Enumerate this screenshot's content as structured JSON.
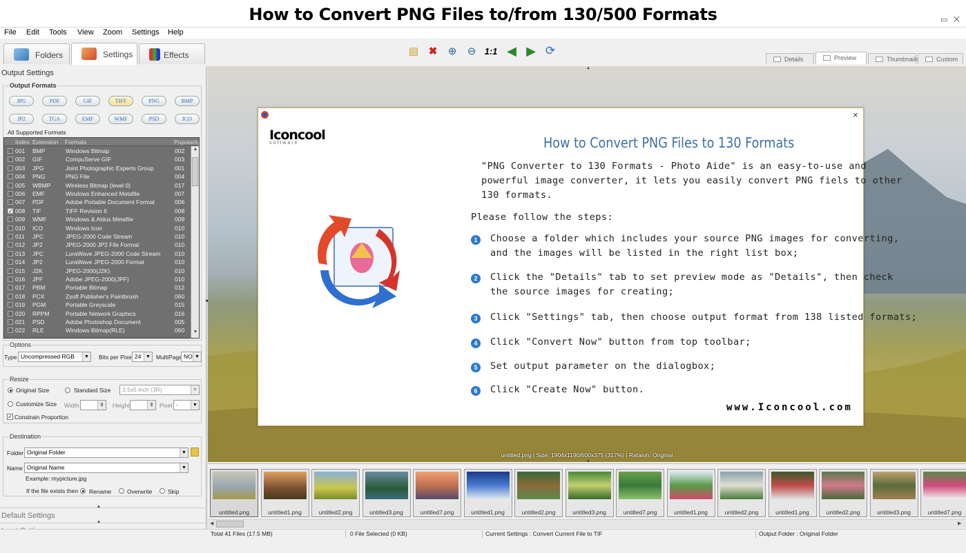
{
  "window": {
    "title": "How to Convert PNG Files to/from 130/500 Formats",
    "controls": [
      "▭",
      "⨉"
    ]
  },
  "menu": [
    "File",
    "Edit",
    "Tools",
    "View",
    "Zoom",
    "Settings",
    "Help"
  ],
  "left_tabs": [
    {
      "label": "Folders",
      "icon": "folders-icon"
    },
    {
      "label": "Settings",
      "icon": "settings-icon"
    },
    {
      "label": "Effects",
      "icon": "effects-icon"
    }
  ],
  "toolbar": [
    "open-icon",
    "delete-icon",
    "zoom-in-icon",
    "zoom-out-icon",
    "1:1",
    "previous-icon",
    "next-icon",
    "convert-icon"
  ],
  "view_tabs": [
    "Details",
    "Preview",
    "Thumbnails",
    "Custom"
  ],
  "output_settings": {
    "header": "Output Settings",
    "formats_title": "Output Formats",
    "format_buttons": [
      "JPG",
      "PDF",
      "GIF",
      "TIFF",
      "PNG",
      "BMP",
      "JP2",
      "TGA",
      "EMF",
      "WMF",
      "PSD",
      "ICO"
    ],
    "selected_format": "TIFF",
    "all_supported_label": "All Supported Formats",
    "list_columns": [
      "Index",
      "Extension",
      "Formats",
      "Popularity"
    ],
    "list_rows": [
      [
        "001",
        "BMP",
        "Windows Bitmap",
        "002"
      ],
      [
        "002",
        "GIF",
        "CompuServe GIF",
        "003"
      ],
      [
        "003",
        "JPG",
        "Joint Photographic Experts Group",
        "001"
      ],
      [
        "004",
        "PNG",
        "PNG File",
        "004"
      ],
      [
        "005",
        "WBMP",
        "Wireless Bitmap (level 0)",
        "017"
      ],
      [
        "006",
        "EMF",
        "Windows Enhanced Metafile",
        "007"
      ],
      [
        "007",
        "PDF",
        "Adobe Portable Document Format",
        "006"
      ],
      [
        "008",
        "TIF",
        "TIFF Revision 6",
        "008"
      ],
      [
        "009",
        "WMF",
        "Windows & Aldus Metafile",
        "009"
      ],
      [
        "010",
        "ICO",
        "Windows Icon",
        "010"
      ],
      [
        "011",
        "JPC",
        "JPEG-2000 Code Stream",
        "010"
      ],
      [
        "012",
        "JP2",
        "JPEG-2000 JP2 File Format",
        "010"
      ],
      [
        "013",
        "JPC",
        "LuraWave JPEG-2000 Code Stream",
        "010"
      ],
      [
        "014",
        "JP2",
        "LuraWave JPEG-2000 Format",
        "010"
      ],
      [
        "015",
        "J2K",
        "JPEG-2000(J2K)",
        "010"
      ],
      [
        "016",
        "JPF",
        "Adobe JPEG-2000(JPF)",
        "010"
      ],
      [
        "017",
        "PBM",
        "Portable Bitmap",
        "012"
      ],
      [
        "018",
        "PCX",
        "Zsoft Publisher's Paintbrush",
        "060"
      ],
      [
        "019",
        "PGM",
        "Portable Greyscale",
        "015"
      ],
      [
        "020",
        "RPPM",
        "Portable Network Graphics",
        "016"
      ],
      [
        "021",
        "PSD",
        "Adobe Photoshop Document",
        "005"
      ],
      [
        "022",
        "RLE",
        "Windows Bitmap(RLE)",
        "060"
      ]
    ],
    "checked_row": "008"
  },
  "options": {
    "title": "Options",
    "type_label": "Type",
    "type_value": "Uncompressed RGB",
    "bpp_label": "Bits per Pixel",
    "bpp_value": "24",
    "multipage_label": "MultiPage",
    "multipage_value": "NO"
  },
  "resize": {
    "title": "Resize",
    "original_size": "Original Size",
    "standard_size": "Standard Size",
    "standard_value": "3.5x5 inch (3R)",
    "customize_size": "Customize Size",
    "width_label": "Width",
    "height_label": "Height",
    "pixel_label": "Pixel",
    "constrain": "Constrain Proportion"
  },
  "destination": {
    "title": "Destination",
    "folder_label": "Folder",
    "folder_value": "Original Folder",
    "name_label": "Name",
    "name_value": "Original Name",
    "example": "Example: mypicture.jpg",
    "exists_label": "If the file exists then",
    "rename": "Rename",
    "overwrite": "Overwrite",
    "skip": "Skip"
  },
  "collapsed_sections": [
    "Default Settings",
    "Input Settings"
  ],
  "document": {
    "logo": "Iconcool",
    "logo_sub": "software",
    "title": "How to Convert PNG Files to 130 Formats",
    "intro": [
      "\"PNG Converter to 130 Formats - Photo Aide\" is an easy-to-use and",
      "powerful image converter, it lets you easily convert PNG fiels to other",
      "130 formats."
    ],
    "follow": "Please follow the steps:",
    "steps": [
      [
        "Choose a folder which includes your source PNG images for converting,",
        "and the images will be listed in the right list box;"
      ],
      [
        "Click the \"Details\" tab to set preview mode as \"Details\", then check",
        "the source images for creating;"
      ],
      [
        "Click \"Settings\" tab, then choose output format from 138 listed formats;"
      ],
      [
        "Click \"Convert Now\" button from top toolbar;"
      ],
      [
        "Set output parameter on the dialogbox;"
      ],
      [
        "Click \"Create Now\" button."
      ]
    ],
    "website": "www.Iconcool.com"
  },
  "preview_caption": "untitled.png | Size: 1904x1190/600x375 (317%) | Rataion: Original",
  "thumbnails": [
    "untitled.png",
    "untitled1.png",
    "untitled2.png",
    "untitled3.png",
    "untitled7.png",
    "untitled1.png",
    "untitled2.png",
    "untitled3.png",
    "untitled7.png",
    "untitled1.png",
    "untitled2.png",
    "untitled1.png",
    "untitled2.png",
    "untitled3.png",
    "untitled7.png"
  ],
  "status": {
    "total": "Total 41 Files (17.5 MB)",
    "selected": "0 File Selected (0 KB)",
    "current": "Current Settings : Convert Current File to TIF",
    "output": "Output Folder : Original Folder"
  }
}
